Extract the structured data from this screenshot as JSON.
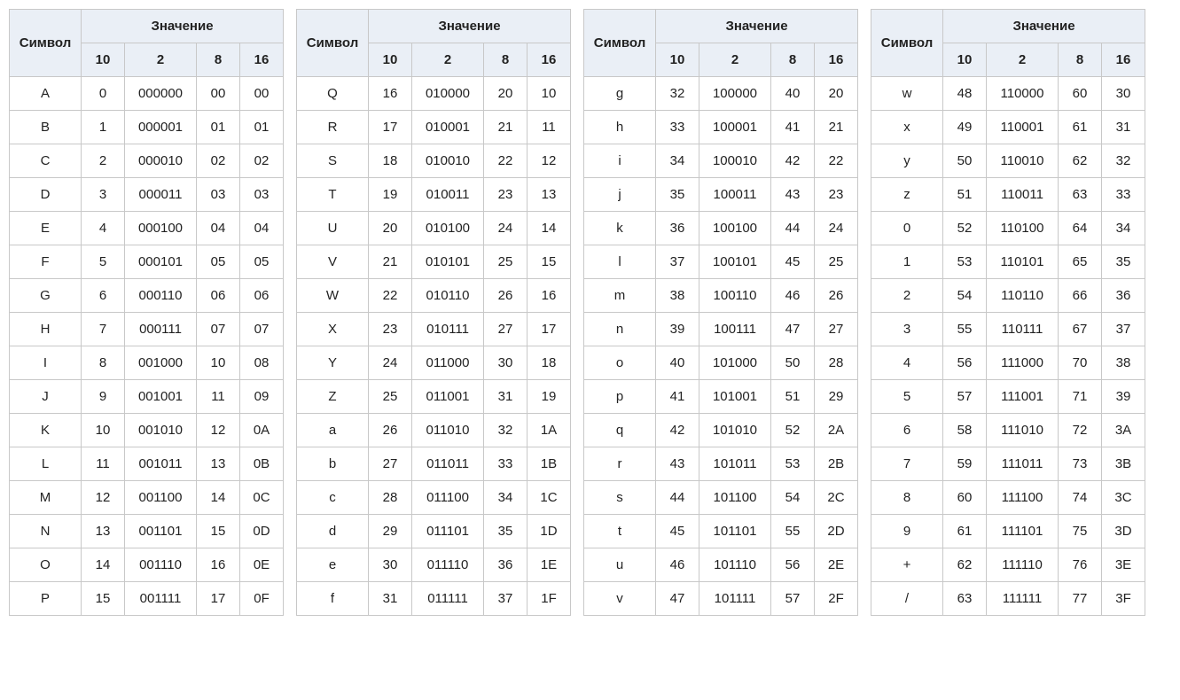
{
  "headers": {
    "symbol": "Символ",
    "value": "Значение",
    "b10": "10",
    "b2": "2",
    "b8": "8",
    "b16": "16"
  },
  "groups": [
    {
      "rows": [
        {
          "sym": "A",
          "d": "0",
          "b": "000000",
          "o": "00",
          "h": "00"
        },
        {
          "sym": "B",
          "d": "1",
          "b": "000001",
          "o": "01",
          "h": "01"
        },
        {
          "sym": "C",
          "d": "2",
          "b": "000010",
          "o": "02",
          "h": "02"
        },
        {
          "sym": "D",
          "d": "3",
          "b": "000011",
          "o": "03",
          "h": "03"
        },
        {
          "sym": "E",
          "d": "4",
          "b": "000100",
          "o": "04",
          "h": "04"
        },
        {
          "sym": "F",
          "d": "5",
          "b": "000101",
          "o": "05",
          "h": "05"
        },
        {
          "sym": "G",
          "d": "6",
          "b": "000110",
          "o": "06",
          "h": "06"
        },
        {
          "sym": "H",
          "d": "7",
          "b": "000111",
          "o": "07",
          "h": "07"
        },
        {
          "sym": "I",
          "d": "8",
          "b": "001000",
          "o": "10",
          "h": "08"
        },
        {
          "sym": "J",
          "d": "9",
          "b": "001001",
          "o": "11",
          "h": "09"
        },
        {
          "sym": "K",
          "d": "10",
          "b": "001010",
          "o": "12",
          "h": "0A"
        },
        {
          "sym": "L",
          "d": "11",
          "b": "001011",
          "o": "13",
          "h": "0B"
        },
        {
          "sym": "M",
          "d": "12",
          "b": "001100",
          "o": "14",
          "h": "0C"
        },
        {
          "sym": "N",
          "d": "13",
          "b": "001101",
          "o": "15",
          "h": "0D"
        },
        {
          "sym": "O",
          "d": "14",
          "b": "001110",
          "o": "16",
          "h": "0E"
        },
        {
          "sym": "P",
          "d": "15",
          "b": "001111",
          "o": "17",
          "h": "0F"
        }
      ]
    },
    {
      "rows": [
        {
          "sym": "Q",
          "d": "16",
          "b": "010000",
          "o": "20",
          "h": "10"
        },
        {
          "sym": "R",
          "d": "17",
          "b": "010001",
          "o": "21",
          "h": "11"
        },
        {
          "sym": "S",
          "d": "18",
          "b": "010010",
          "o": "22",
          "h": "12"
        },
        {
          "sym": "T",
          "d": "19",
          "b": "010011",
          "o": "23",
          "h": "13"
        },
        {
          "sym": "U",
          "d": "20",
          "b": "010100",
          "o": "24",
          "h": "14"
        },
        {
          "sym": "V",
          "d": "21",
          "b": "010101",
          "o": "25",
          "h": "15"
        },
        {
          "sym": "W",
          "d": "22",
          "b": "010110",
          "o": "26",
          "h": "16"
        },
        {
          "sym": "X",
          "d": "23",
          "b": "010111",
          "o": "27",
          "h": "17"
        },
        {
          "sym": "Y",
          "d": "24",
          "b": "011000",
          "o": "30",
          "h": "18"
        },
        {
          "sym": "Z",
          "d": "25",
          "b": "011001",
          "o": "31",
          "h": "19"
        },
        {
          "sym": "a",
          "d": "26",
          "b": "011010",
          "o": "32",
          "h": "1A"
        },
        {
          "sym": "b",
          "d": "27",
          "b": "011011",
          "o": "33",
          "h": "1B"
        },
        {
          "sym": "c",
          "d": "28",
          "b": "011100",
          "o": "34",
          "h": "1C"
        },
        {
          "sym": "d",
          "d": "29",
          "b": "011101",
          "o": "35",
          "h": "1D"
        },
        {
          "sym": "e",
          "d": "30",
          "b": "011110",
          "o": "36",
          "h": "1E"
        },
        {
          "sym": "f",
          "d": "31",
          "b": "011111",
          "o": "37",
          "h": "1F"
        }
      ]
    },
    {
      "rows": [
        {
          "sym": "g",
          "d": "32",
          "b": "100000",
          "o": "40",
          "h": "20"
        },
        {
          "sym": "h",
          "d": "33",
          "b": "100001",
          "o": "41",
          "h": "21"
        },
        {
          "sym": "i",
          "d": "34",
          "b": "100010",
          "o": "42",
          "h": "22"
        },
        {
          "sym": "j",
          "d": "35",
          "b": "100011",
          "o": "43",
          "h": "23"
        },
        {
          "sym": "k",
          "d": "36",
          "b": "100100",
          "o": "44",
          "h": "24"
        },
        {
          "sym": "l",
          "d": "37",
          "b": "100101",
          "o": "45",
          "h": "25"
        },
        {
          "sym": "m",
          "d": "38",
          "b": "100110",
          "o": "46",
          "h": "26"
        },
        {
          "sym": "n",
          "d": "39",
          "b": "100111",
          "o": "47",
          "h": "27"
        },
        {
          "sym": "o",
          "d": "40",
          "b": "101000",
          "o": "50",
          "h": "28"
        },
        {
          "sym": "p",
          "d": "41",
          "b": "101001",
          "o": "51",
          "h": "29"
        },
        {
          "sym": "q",
          "d": "42",
          "b": "101010",
          "o": "52",
          "h": "2A"
        },
        {
          "sym": "r",
          "d": "43",
          "b": "101011",
          "o": "53",
          "h": "2B"
        },
        {
          "sym": "s",
          "d": "44",
          "b": "101100",
          "o": "54",
          "h": "2C"
        },
        {
          "sym": "t",
          "d": "45",
          "b": "101101",
          "o": "55",
          "h": "2D"
        },
        {
          "sym": "u",
          "d": "46",
          "b": "101110",
          "o": "56",
          "h": "2E"
        },
        {
          "sym": "v",
          "d": "47",
          "b": "101111",
          "o": "57",
          "h": "2F"
        }
      ]
    },
    {
      "rows": [
        {
          "sym": "w",
          "d": "48",
          "b": "110000",
          "o": "60",
          "h": "30"
        },
        {
          "sym": "x",
          "d": "49",
          "b": "110001",
          "o": "61",
          "h": "31"
        },
        {
          "sym": "y",
          "d": "50",
          "b": "110010",
          "o": "62",
          "h": "32"
        },
        {
          "sym": "z",
          "d": "51",
          "b": "110011",
          "o": "63",
          "h": "33"
        },
        {
          "sym": "0",
          "d": "52",
          "b": "110100",
          "o": "64",
          "h": "34"
        },
        {
          "sym": "1",
          "d": "53",
          "b": "110101",
          "o": "65",
          "h": "35"
        },
        {
          "sym": "2",
          "d": "54",
          "b": "110110",
          "o": "66",
          "h": "36"
        },
        {
          "sym": "3",
          "d": "55",
          "b": "110111",
          "o": "67",
          "h": "37"
        },
        {
          "sym": "4",
          "d": "56",
          "b": "111000",
          "o": "70",
          "h": "38"
        },
        {
          "sym": "5",
          "d": "57",
          "b": "111001",
          "o": "71",
          "h": "39"
        },
        {
          "sym": "6",
          "d": "58",
          "b": "111010",
          "o": "72",
          "h": "3A"
        },
        {
          "sym": "7",
          "d": "59",
          "b": "111011",
          "o": "73",
          "h": "3B"
        },
        {
          "sym": "8",
          "d": "60",
          "b": "111100",
          "o": "74",
          "h": "3C"
        },
        {
          "sym": "9",
          "d": "61",
          "b": "111101",
          "o": "75",
          "h": "3D"
        },
        {
          "sym": "+",
          "d": "62",
          "b": "111110",
          "o": "76",
          "h": "3E"
        },
        {
          "sym": "/",
          "d": "63",
          "b": "111111",
          "o": "77",
          "h": "3F"
        }
      ]
    }
  ]
}
